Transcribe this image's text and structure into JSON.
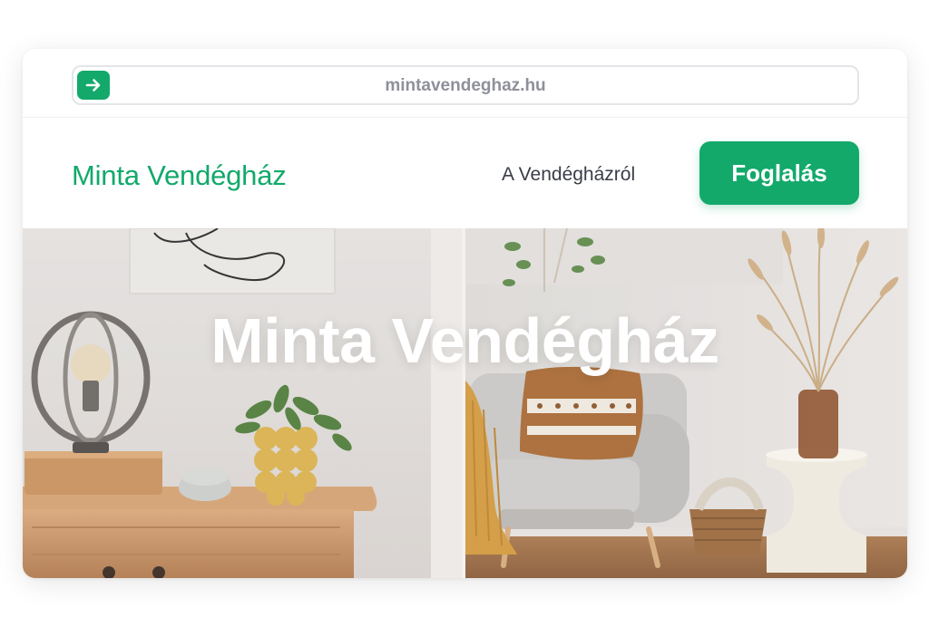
{
  "browser": {
    "url": "mintavendeghaz.hu",
    "go_icon": "arrow-right-icon"
  },
  "header": {
    "brand": "Minta Vendégház",
    "nav_link": "A Vendégházról",
    "book_button": "Foglalás"
  },
  "hero": {
    "title": "Minta Vendégház",
    "image": "living-room-photo"
  },
  "colors": {
    "accent": "#13a96b",
    "text_dark": "#3a3d48",
    "url_gray": "#8e909a"
  }
}
